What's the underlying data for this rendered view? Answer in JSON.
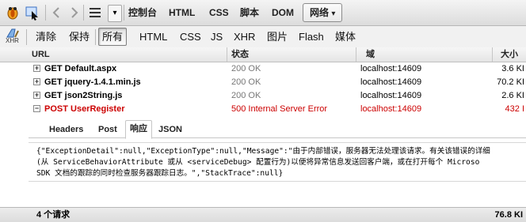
{
  "toolbar": {
    "panels": [
      "控制台",
      "HTML",
      "CSS",
      "脚本",
      "DOM"
    ],
    "active_panel": "网络",
    "active_panel_arrow": "▾",
    "menu_dropdown_glyph": "▾"
  },
  "filterbar": {
    "icon_caption": "XHR",
    "clear_label": "清除",
    "persist_label": "保持",
    "filters": [
      "所有",
      "HTML",
      "CSS",
      "JS",
      "XHR",
      "图片",
      "Flash",
      "媒体"
    ],
    "active_filter": "所有"
  },
  "table": {
    "headers": {
      "url": "URL",
      "status": "状态",
      "domain": "域",
      "size": "大小"
    },
    "rows": [
      {
        "expander": "+",
        "url": "GET Default.aspx",
        "status": "200 OK",
        "domain": "localhost:14609",
        "size": "3.6 KI",
        "error": false
      },
      {
        "expander": "+",
        "url": "GET jquery-1.4.1.min.js",
        "status": "200 OK",
        "domain": "localhost:14609",
        "size": "70.2 KI",
        "error": false
      },
      {
        "expander": "+",
        "url": "GET json2String.js",
        "status": "200 OK",
        "domain": "localhost:14609",
        "size": "2.6 KI",
        "error": false
      },
      {
        "expander": "−",
        "url": "POST UserRegister",
        "status": "500 Internal Server Error",
        "domain": "localhost:14609",
        "size": "432 I",
        "error": true
      }
    ]
  },
  "detail": {
    "tabs": [
      "Headers",
      "Post",
      "响应",
      "JSON"
    ],
    "active_tab": "响应",
    "response_lines": [
      "{\"ExceptionDetail\":null,\"ExceptionType\":null,\"Message\":\"由于内部错误，服务器无法处理该请求。有关该错误的详细",
      "(从 ServiceBehaviorAttribute 或从 <serviceDebug> 配置行为)以便将异常信息发送回客户端，或在打开每个 Microso",
      "SDK 文档的跟踪的同时检查服务器跟踪日志。\",\"StackTrace\":null}"
    ]
  },
  "footer": {
    "request_count": "4 个请求",
    "total_size": "76.8 KI"
  },
  "colors": {
    "error_red": "#cc0000",
    "status_gray": "#777777",
    "accent_blue": "#1f5fbf"
  }
}
